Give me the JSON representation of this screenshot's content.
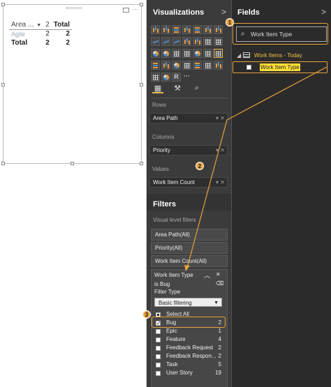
{
  "canvas": {
    "matrix": {
      "header": {
        "col1": "Area ...",
        "col2": "2",
        "col3": "Total"
      },
      "rows": [
        {
          "label": "Agile",
          "v1": "2",
          "v2": "2"
        },
        {
          "label": "Total",
          "v1": "2",
          "v2": "2"
        }
      ]
    }
  },
  "viz_pane": {
    "title": "Visualizations",
    "chevron": ">",
    "icon_r": "R",
    "icon_more": "···",
    "rows_label": "Rows",
    "rows_value": "Area Path",
    "columns_label": "Columns",
    "columns_value": "Priority",
    "values_label": "Values",
    "values_value": "Work Item Count"
  },
  "filters": {
    "title": "Filters",
    "subtitle": "Visual level filters",
    "cards": [
      "Area Path(All)",
      "Priority(All)",
      "Work Item Count(All)"
    ],
    "open_card": {
      "title": "Work Item Type",
      "summary": "is Bug",
      "filter_type_label": "Filter Type",
      "filter_type_value": "Basic filtering",
      "options": [
        {
          "label": "Select All",
          "count": "",
          "state": "mixed"
        },
        {
          "label": "Bug",
          "count": "2",
          "state": "checked"
        },
        {
          "label": "Epic",
          "count": "1",
          "state": "unchecked"
        },
        {
          "label": "Feature",
          "count": "4",
          "state": "unchecked"
        },
        {
          "label": "Feedback Request",
          "count": "2",
          "state": "unchecked"
        },
        {
          "label": "Feedback Respon...",
          "count": "2",
          "state": "unchecked"
        },
        {
          "label": "Task",
          "count": "5",
          "state": "unchecked"
        },
        {
          "label": "User Story",
          "count": "19",
          "state": "unchecked"
        }
      ]
    }
  },
  "fields_pane": {
    "title": "Fields",
    "chevron": ">",
    "search_value": "Work Item Type",
    "table_name": "Work Items - Today",
    "field_name": "Work Item Type"
  },
  "callouts": [
    "1",
    "2",
    "3"
  ],
  "colors": {
    "accent": "#e8a33d",
    "highlight": "#ffe033",
    "pane_bg": "#3b3b3b",
    "fields_bg": "#2b2b2b"
  }
}
